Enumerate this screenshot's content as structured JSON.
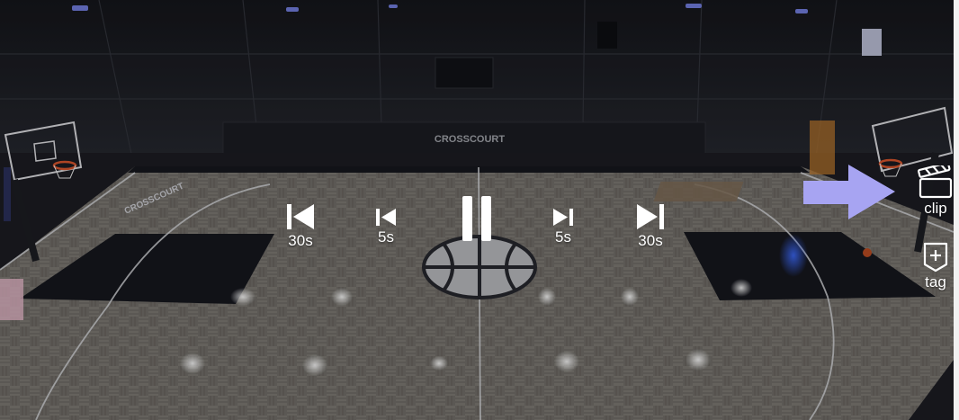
{
  "scene": {
    "court_brand_wall": "CROSSCOURT",
    "court_brand_floor": "CROSSCOURT"
  },
  "controls": {
    "skip_back_30": {
      "label": "30s",
      "icon": "skip-back-icon"
    },
    "skip_back_5": {
      "label": "5s",
      "icon": "skip-back-icon"
    },
    "play_pause": {
      "state": "playing",
      "icon": "pause-icon"
    },
    "skip_forward_5": {
      "label": "5s",
      "icon": "skip-forward-icon"
    },
    "skip_forward_30": {
      "label": "30s",
      "icon": "skip-forward-icon"
    }
  },
  "side_actions": {
    "clip": {
      "label": "clip",
      "icon": "clapperboard-icon"
    },
    "tag": {
      "label": "tag",
      "icon": "tag-plus-icon"
    }
  },
  "annotation": {
    "arrow_icon": "arrow-right-icon",
    "arrow_color": "#a7a4f2"
  },
  "colors": {
    "control_white": "#ffffff",
    "court_floor": "#6e6b66",
    "paint_area": "#16171f",
    "wall": "#1d1f26"
  }
}
